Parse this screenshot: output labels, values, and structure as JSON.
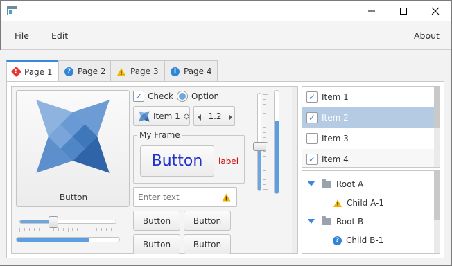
{
  "window": {
    "icon": "app-window-icon",
    "controls": [
      "minimize-icon",
      "maximize-icon",
      "close-icon"
    ]
  },
  "menubar": {
    "file": "File",
    "edit": "Edit",
    "about": "About"
  },
  "tabs": [
    {
      "label": "Page 1",
      "icon": "error-icon",
      "color": "#e53935",
      "glyph": "!",
      "selected": true
    },
    {
      "label": "Page 2",
      "icon": "question-icon",
      "color": "#2f86d8",
      "glyph": "?",
      "selected": false
    },
    {
      "label": "Page 3",
      "icon": "warning-icon",
      "color": "#f2b600",
      "glyph": "!",
      "selected": false
    },
    {
      "label": "Page 4",
      "icon": "info-icon",
      "color": "#2f86d8",
      "glyph": "i",
      "selected": false
    }
  ],
  "page1": {
    "big_button": {
      "label": "Button",
      "icon": "haxe-logo-icon"
    },
    "horizontal_slider": {
      "value": 0.33
    },
    "progress_bar": {
      "value": 0.71
    },
    "check": {
      "label": "Check",
      "checked": true
    },
    "option": {
      "label": "Option",
      "selected": true
    },
    "combo": {
      "value": "Item 1",
      "icon": "haxe-logo-icon"
    },
    "spinner": {
      "value": "1.2"
    },
    "frame": {
      "title": "My Frame",
      "button_label": "Button",
      "label": "label",
      "label_color": "#cc0000"
    },
    "text_field": {
      "placeholder": "Enter text",
      "icon": "warning-icon"
    },
    "grid_buttons": [
      "Button",
      "Button",
      "Button",
      "Button"
    ],
    "vertical_slider_1": {
      "value": 0.45
    },
    "vertical_slider_2": {
      "value": 0.71
    }
  },
  "list": {
    "items": [
      {
        "label": "Item 1",
        "checked": true,
        "selected": false
      },
      {
        "label": "Item 2",
        "checked": true,
        "selected": true
      },
      {
        "label": "Item 3",
        "checked": false,
        "selected": false
      },
      {
        "label": "Item 4",
        "checked": true,
        "selected": false
      }
    ]
  },
  "tree": {
    "nodes": [
      {
        "label": "Root A",
        "icon": "folder-icon",
        "level": 0,
        "expanded": true
      },
      {
        "label": "Child A-1",
        "icon": "warning-icon",
        "level": 1
      },
      {
        "label": "Root B",
        "icon": "folder-icon",
        "level": 0,
        "expanded": true
      },
      {
        "label": "Child B-1",
        "icon": "question-icon",
        "level": 1
      }
    ]
  },
  "colors": {
    "accent": "#3b87d9",
    "selection": "#b4cbe3",
    "progress": "#5b9ee1"
  }
}
